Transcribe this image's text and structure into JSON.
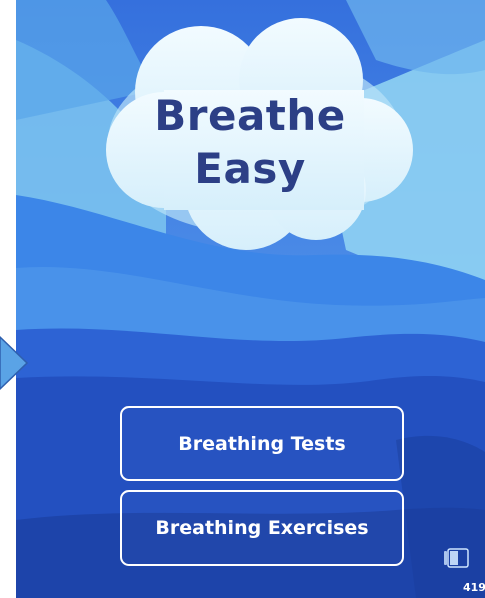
{
  "app": {
    "title_line1": "Breathe",
    "title_line2": "Easy"
  },
  "menu": {
    "tests_label": "Breathing Tests",
    "exercises_label": "Breathing Exercises"
  },
  "status": {
    "battery_text": "419"
  },
  "icons": {
    "left_arrow": "left-arrow-icon",
    "battery": "battery-icon",
    "cloud": "cloud-icon"
  },
  "colors": {
    "title": "#2c3f86",
    "sky_light": "#8fd2f3",
    "sky_blue": "#3f8fe6",
    "deep_blue": "#1a3e9c",
    "button_border": "#ffffff"
  }
}
